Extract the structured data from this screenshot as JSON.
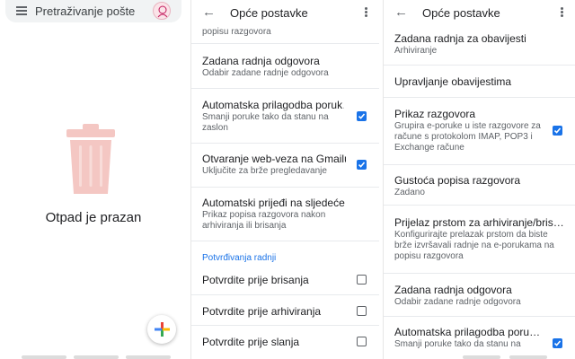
{
  "inbox": {
    "search_placeholder": "Pretraživanje pošte",
    "empty_message": "Otpad je prazan"
  },
  "settings_left": {
    "title": "Opće postavke",
    "partial_top": "popisu razgovora",
    "items": [
      {
        "title": "Zadana radnja odgovora",
        "subtitle": "Odabir zadane radnje odgovora"
      },
      {
        "title": "Automatska prilagodba poruk…",
        "subtitle": "Smanji poruke tako da stanu na zaslon",
        "checked": true
      },
      {
        "title": "Otvaranje web-veza na Gmailu",
        "subtitle": "Uključite za brže pregledavanje",
        "checked": true
      },
      {
        "title": "Automatski prijeđi na sljedeće",
        "subtitle": "Prikaz popisa razgovora nakon arhiviranja ili brisanja"
      }
    ],
    "section_title": "Potvrđivanja radnji",
    "confirmations": [
      {
        "title": "Potvrdite prije brisanja",
        "checked": false
      },
      {
        "title": "Potvrdite prije arhiviranja",
        "checked": false
      },
      {
        "title": "Potvrdite prije slanja",
        "checked": false
      }
    ]
  },
  "settings_right": {
    "title": "Opće postavke",
    "items": [
      {
        "title": "Zadana radnja za obavijesti",
        "subtitle": "Arhiviranje"
      },
      {
        "title": "Upravljanje obavijestima",
        "subtitle": ""
      },
      {
        "title": "Prikaz razgovora",
        "subtitle": "Grupira e-poruke u iste razgovore za račune s protokolom IMAP, POP3 i Exchange račune",
        "checked": true
      },
      {
        "title": "Gustoća popisa razgovora",
        "subtitle": "Zadano"
      },
      {
        "title": "Prijelaz prstom za arhiviranje/bris…",
        "subtitle": "Konfigurirajte prelazak prstom da biste brže izvršavali radnje na e-porukama na popisu razgovora"
      },
      {
        "title": "Zadana radnja odgovora",
        "subtitle": "Odabir zadane radnje odgovora"
      },
      {
        "title": "Automatska prilagodba poru…",
        "subtitle": "Smanji poruke tako da stanu na",
        "checked": true
      }
    ]
  },
  "colors": {
    "accent": "#1a73e8",
    "trash": "#f4c7c3",
    "text": "#202124",
    "subtext": "#5f6368"
  },
  "icons": [
    "menu-icon",
    "avatar",
    "trash-icon",
    "compose-plus-icon",
    "back-arrow-icon",
    "more-vert-icon",
    "checkbox-checked-icon",
    "checkbox-empty-icon"
  ]
}
